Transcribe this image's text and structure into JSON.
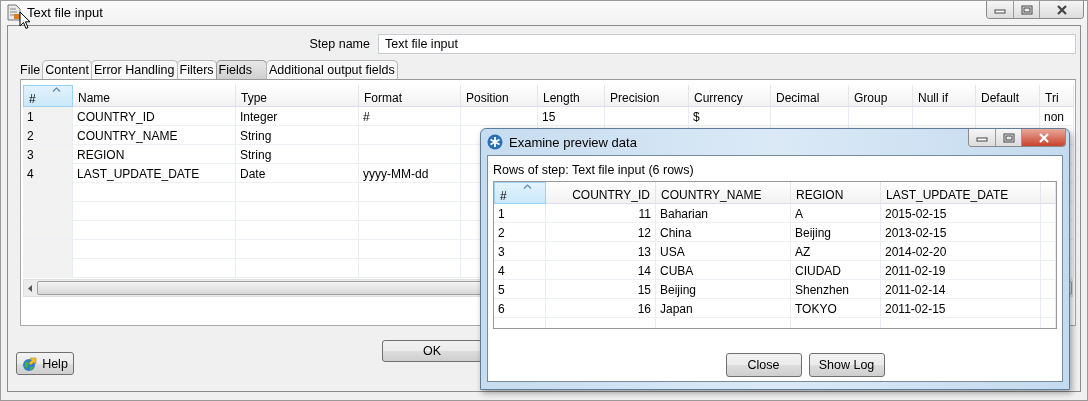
{
  "window": {
    "title": "Text file input"
  },
  "step_name": {
    "label": "Step name",
    "value": "Text file input"
  },
  "tabs": [
    {
      "label": "File",
      "selected": false
    },
    {
      "label": "Content",
      "selected": false
    },
    {
      "label": "Error Handling",
      "selected": false
    },
    {
      "label": "Filters",
      "selected": false
    },
    {
      "label": "Fields",
      "selected": true
    },
    {
      "label": "Additional output fields",
      "selected": false
    }
  ],
  "fields_table": {
    "columns": [
      {
        "label": "#",
        "sorted": true
      },
      {
        "label": "Name",
        "sorted": false
      },
      {
        "label": "Type",
        "sorted": false
      },
      {
        "label": "Format",
        "sorted": false
      },
      {
        "label": "Position",
        "sorted": false
      },
      {
        "label": "Length",
        "sorted": false
      },
      {
        "label": "Precision",
        "sorted": false
      },
      {
        "label": "Currency",
        "sorted": false
      },
      {
        "label": "Decimal",
        "sorted": false
      },
      {
        "label": "Group",
        "sorted": false
      },
      {
        "label": "Null if",
        "sorted": false
      },
      {
        "label": "Default",
        "sorted": false
      },
      {
        "label": "Tri",
        "sorted": false
      }
    ],
    "rows": [
      {
        "number": "1",
        "name": "COUNTRY_ID",
        "type": "Integer",
        "format": "#",
        "length": "15",
        "currency": "$",
        "trim": "non"
      },
      {
        "number": "2",
        "name": "COUNTRY_NAME",
        "type": "String"
      },
      {
        "number": "3",
        "name": "REGION",
        "type": "String"
      },
      {
        "number": "4",
        "name": "LAST_UPDATE_DATE",
        "type": "Date",
        "format": "yyyy-MM-dd"
      }
    ]
  },
  "buttons": {
    "ok": "OK",
    "help": "Help"
  },
  "preview_dialog": {
    "title": "Examine preview data",
    "caption": "Rows of step: Text file input (6 rows)",
    "columns": [
      {
        "label": "#",
        "sorted": true
      },
      {
        "label": "COUNTRY_ID",
        "sorted": false
      },
      {
        "label": "COUNTRY_NAME",
        "sorted": false
      },
      {
        "label": "REGION",
        "sorted": false
      },
      {
        "label": "LAST_UPDATE_DATE",
        "sorted": false
      }
    ],
    "rows": [
      [
        "1",
        "11",
        "Baharian",
        "A",
        "2015-02-15"
      ],
      [
        "2",
        "12",
        "China",
        "Beijing",
        "2013-02-15"
      ],
      [
        "3",
        "13",
        "USA",
        "AZ",
        "2014-02-20"
      ],
      [
        "4",
        "14",
        "CUBA",
        "CIUDAD",
        "2011-02-19"
      ],
      [
        "5",
        "15",
        "Beijing",
        "Shenzhen",
        "2011-02-14"
      ],
      [
        "6",
        "16",
        "Japan",
        "TOKYO",
        "2011-02-15"
      ]
    ],
    "buttons": [
      "Close",
      "Show Log"
    ]
  }
}
